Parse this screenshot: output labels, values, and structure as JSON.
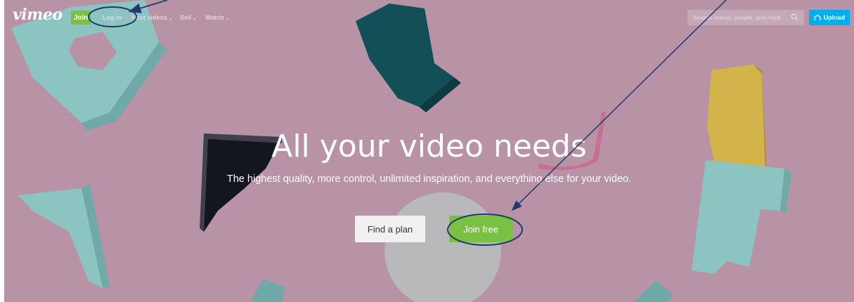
{
  "nav": {
    "logo": "vimeo",
    "join_label": "Join",
    "login_label": "Log in",
    "links": [
      {
        "label": "Host videos"
      },
      {
        "label": "Sell"
      },
      {
        "label": "Watch"
      }
    ],
    "search_placeholder": "Search videos, people, and more",
    "upload_label": "Upload"
  },
  "hero": {
    "headline": "All your video needs",
    "subline": "The highest quality, more control, unlimited inspiration, and everything else for your video.",
    "find_plan_label": "Find a plan",
    "join_free_label": "Join free"
  },
  "icons": {
    "search": "search-icon",
    "upload": "upload-icon",
    "chevron": "chevron-down-icon"
  },
  "colors": {
    "background": "#b892a5",
    "brand_green": "#7ac143",
    "upload_blue": "#00adef",
    "annotation": "#1f3a6e"
  }
}
